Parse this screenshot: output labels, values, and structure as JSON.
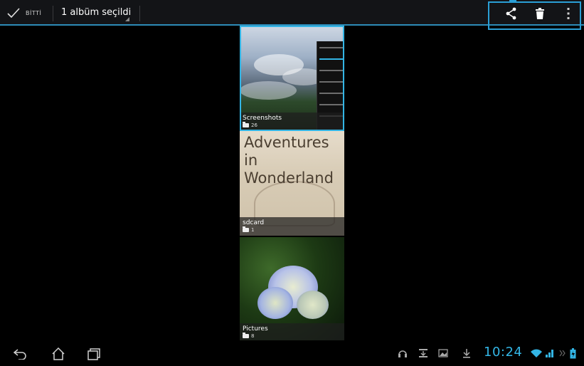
{
  "actionbar": {
    "done_label": "BİTTİ",
    "selection_label": "1 albüm seçildi",
    "accent_color": "#33b5e5",
    "actions": [
      "share-icon",
      "trash-icon",
      "overflow-menu-icon"
    ]
  },
  "albums": [
    {
      "name": "Screenshots",
      "count": "26",
      "selected": true
    },
    {
      "name": "sdcard",
      "count": "1",
      "selected": false,
      "cover_text": "Adventures\nin Wonderland"
    },
    {
      "name": "Pictures",
      "count": "8",
      "selected": false
    }
  ],
  "navbar": {
    "buttons": [
      "back-icon",
      "home-icon",
      "recent-apps-icon"
    ],
    "clock": "10:24",
    "notification_icons": [
      "headphones-icon",
      "download-box-icon",
      "image-icon",
      "download-icon"
    ],
    "status_icons": [
      "wifi-icon",
      "signal-icon",
      "battery-icon"
    ]
  }
}
